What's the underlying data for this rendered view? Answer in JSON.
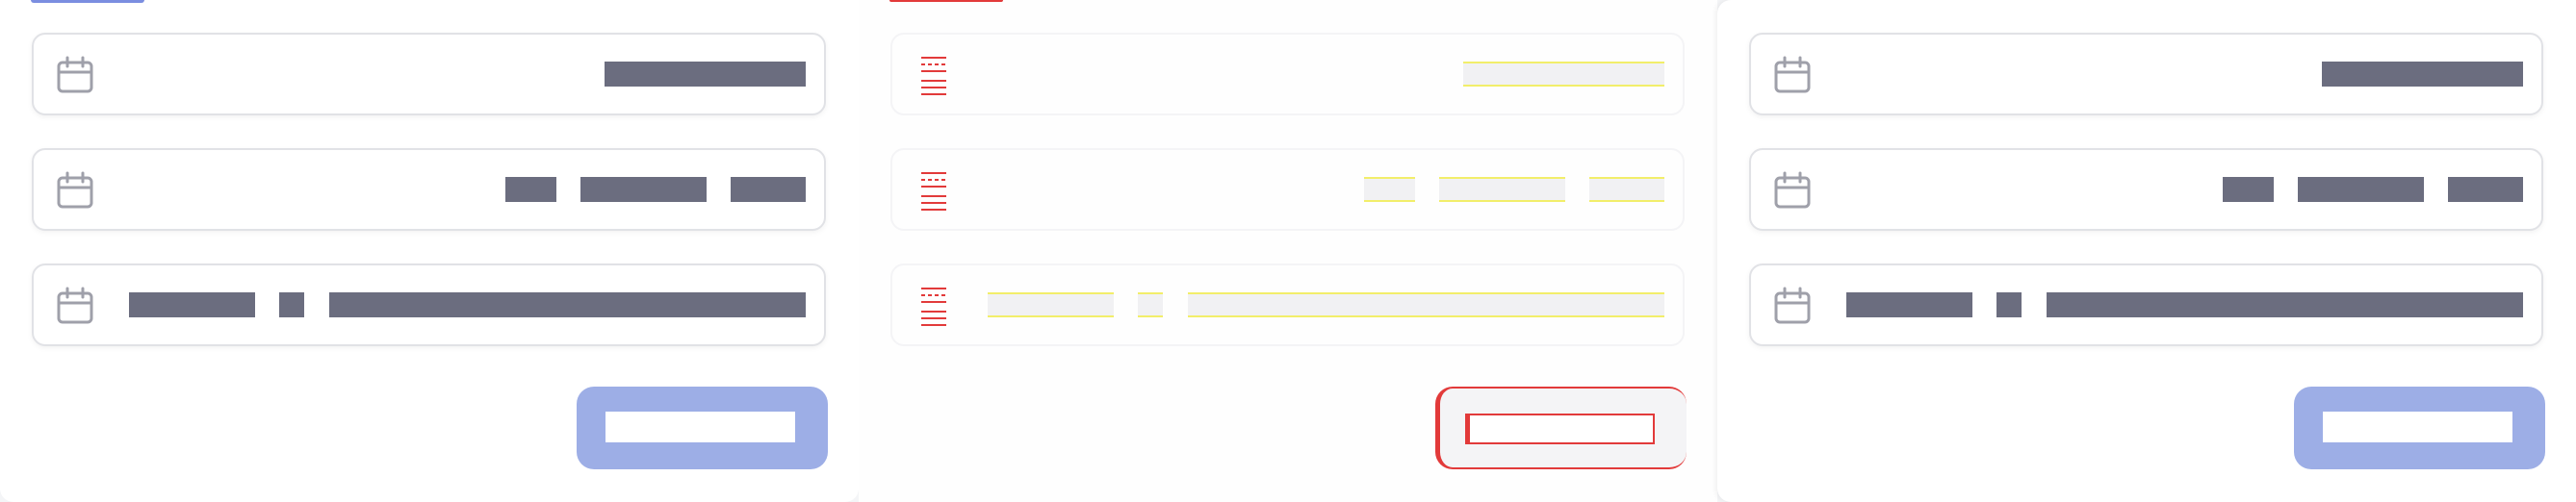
{
  "colors": {
    "row_border": "#e1e2e6",
    "value_bar": "#6b6d7f",
    "icon": "#9fa0aa",
    "primary_button": "#9daee6",
    "accent_blue": "#7b8ee0",
    "accent_red": "#e23a3a",
    "highlight_yellow": "#f2ee6a"
  },
  "icons": {
    "calendar": "calendar-icon"
  },
  "panels": [
    {
      "accent_color": "#7b8ee0",
      "rows": [
        {
          "segments": [
            ""
          ]
        },
        {
          "segments": [
            "",
            "",
            ""
          ]
        },
        {
          "segments": [
            "",
            "",
            ""
          ]
        }
      ],
      "button": {
        "label": ""
      }
    },
    {
      "accent_color": "#e23a3a",
      "rows": [
        {
          "segments": [
            ""
          ]
        },
        {
          "segments": [
            "",
            "",
            ""
          ]
        },
        {
          "segments": [
            "",
            "",
            ""
          ]
        }
      ],
      "button": {
        "label": ""
      }
    },
    {
      "accent_color": "",
      "rows": [
        {
          "segments": [
            ""
          ]
        },
        {
          "segments": [
            "",
            "",
            ""
          ]
        },
        {
          "segments": [
            "",
            "",
            ""
          ]
        }
      ],
      "button": {
        "label": ""
      }
    }
  ]
}
